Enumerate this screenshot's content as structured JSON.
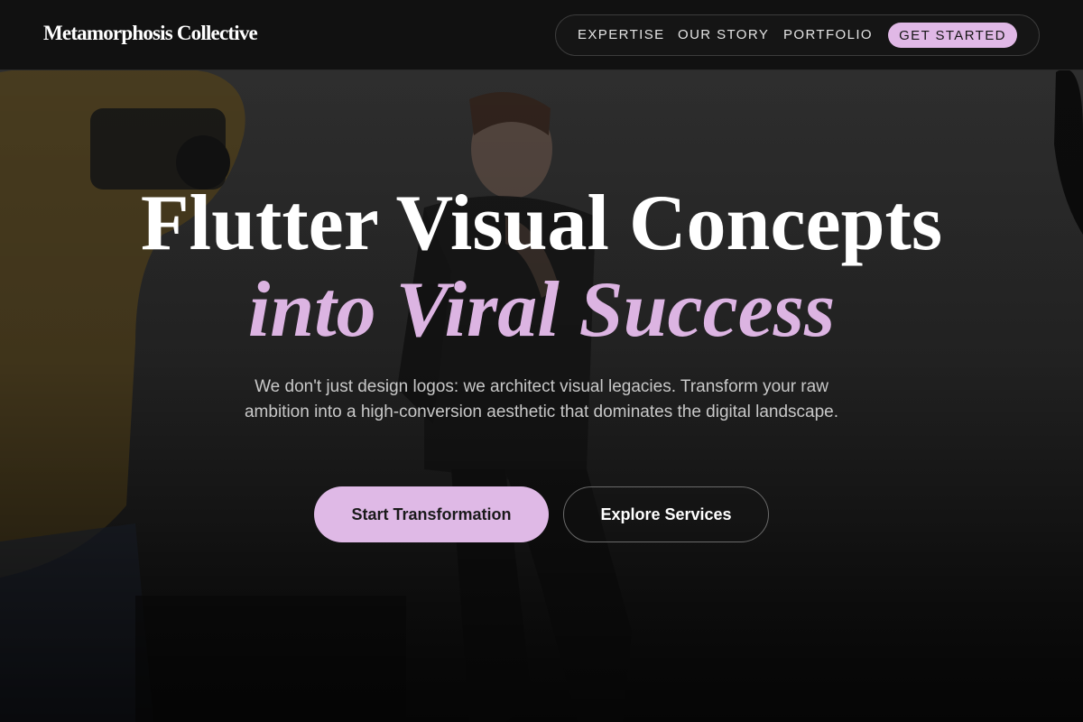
{
  "header": {
    "logo": "Metamorphosis Collective",
    "nav": {
      "expertise": "EXPERTISE",
      "our_story": "OUR STORY",
      "portfolio": "PORTFOLIO",
      "get_started": "GET STARTED"
    }
  },
  "hero": {
    "headline_line1": "Flutter Visual Concepts",
    "headline_line2": "into Viral Success",
    "subtitle": "We don't just design logos: we architect visual legacies. Transform your raw ambition into a high-conversion aesthetic that dominates the digital landscape.",
    "primary_button": "Start Transformation",
    "secondary_button": "Explore Services",
    "background_image": "photo-shoot-scene"
  },
  "colors": {
    "accent": "#dfb9e6",
    "header_bg": "#111111",
    "headline_white": "#ffffff",
    "headline_accent": "#dcb4e2",
    "subtitle": "#c8c8c8"
  }
}
